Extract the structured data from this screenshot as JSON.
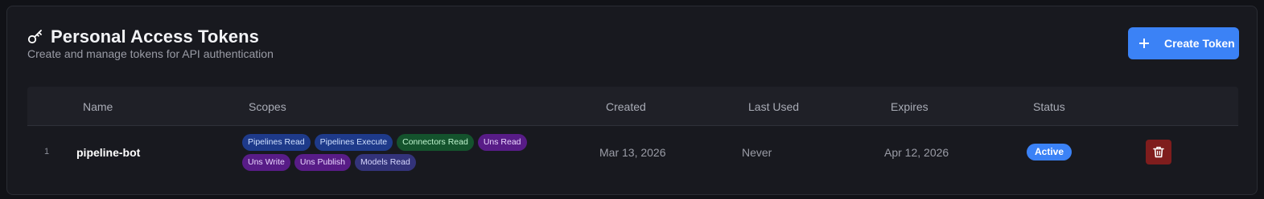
{
  "header": {
    "title": "Personal Access Tokens",
    "subtitle": "Create and manage tokens for API authentication",
    "icon": "key-icon",
    "create_button": {
      "label": "Create Token",
      "icon": "plus-icon"
    }
  },
  "table": {
    "columns": [
      "Name",
      "Scopes",
      "Created",
      "Last Used",
      "Expires",
      "Status"
    ],
    "rows": [
      {
        "index": "1",
        "name": "pipeline-bot",
        "scopes": [
          {
            "label": "Pipelines Read",
            "color": "#1e3a8a"
          },
          {
            "label": "Pipelines Execute",
            "color": "#1e3a8a"
          },
          {
            "label": "Connectors Read",
            "color": "#14532d"
          },
          {
            "label": "Uns Read",
            "color": "#581c87"
          },
          {
            "label": "Uns Write",
            "color": "#581c87"
          },
          {
            "label": "Uns Publish",
            "color": "#581c87"
          },
          {
            "label": "Models Read",
            "color": "#33337a"
          }
        ],
        "created": "Mar 13, 2026",
        "last_used": "Never",
        "expires": "Apr 12, 2026",
        "status": "Active",
        "delete_icon": "trash-icon"
      }
    ]
  },
  "colors": {
    "accent": "#3b82f6",
    "danger": "#7f1d1d",
    "background": "#18191f"
  }
}
